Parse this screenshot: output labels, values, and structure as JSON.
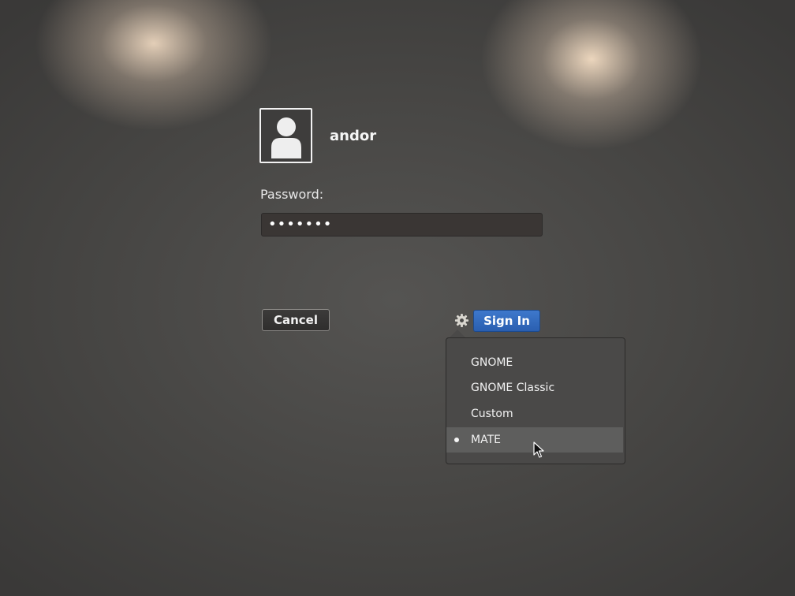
{
  "user": {
    "name": "andor",
    "avatar_icon": "user-silhouette-icon"
  },
  "password": {
    "label": "Password:",
    "value": "•••••••"
  },
  "buttons": {
    "cancel": "Cancel",
    "sign_in": "Sign In"
  },
  "session_menu": {
    "icon": "gear-icon",
    "items": [
      {
        "label": "GNOME",
        "selected": false
      },
      {
        "label": "GNOME Classic",
        "selected": false
      },
      {
        "label": "Custom",
        "selected": false
      },
      {
        "label": "MATE",
        "selected": true
      }
    ]
  },
  "colors": {
    "accent": "#2f66b8",
    "background": "#4a4947"
  }
}
